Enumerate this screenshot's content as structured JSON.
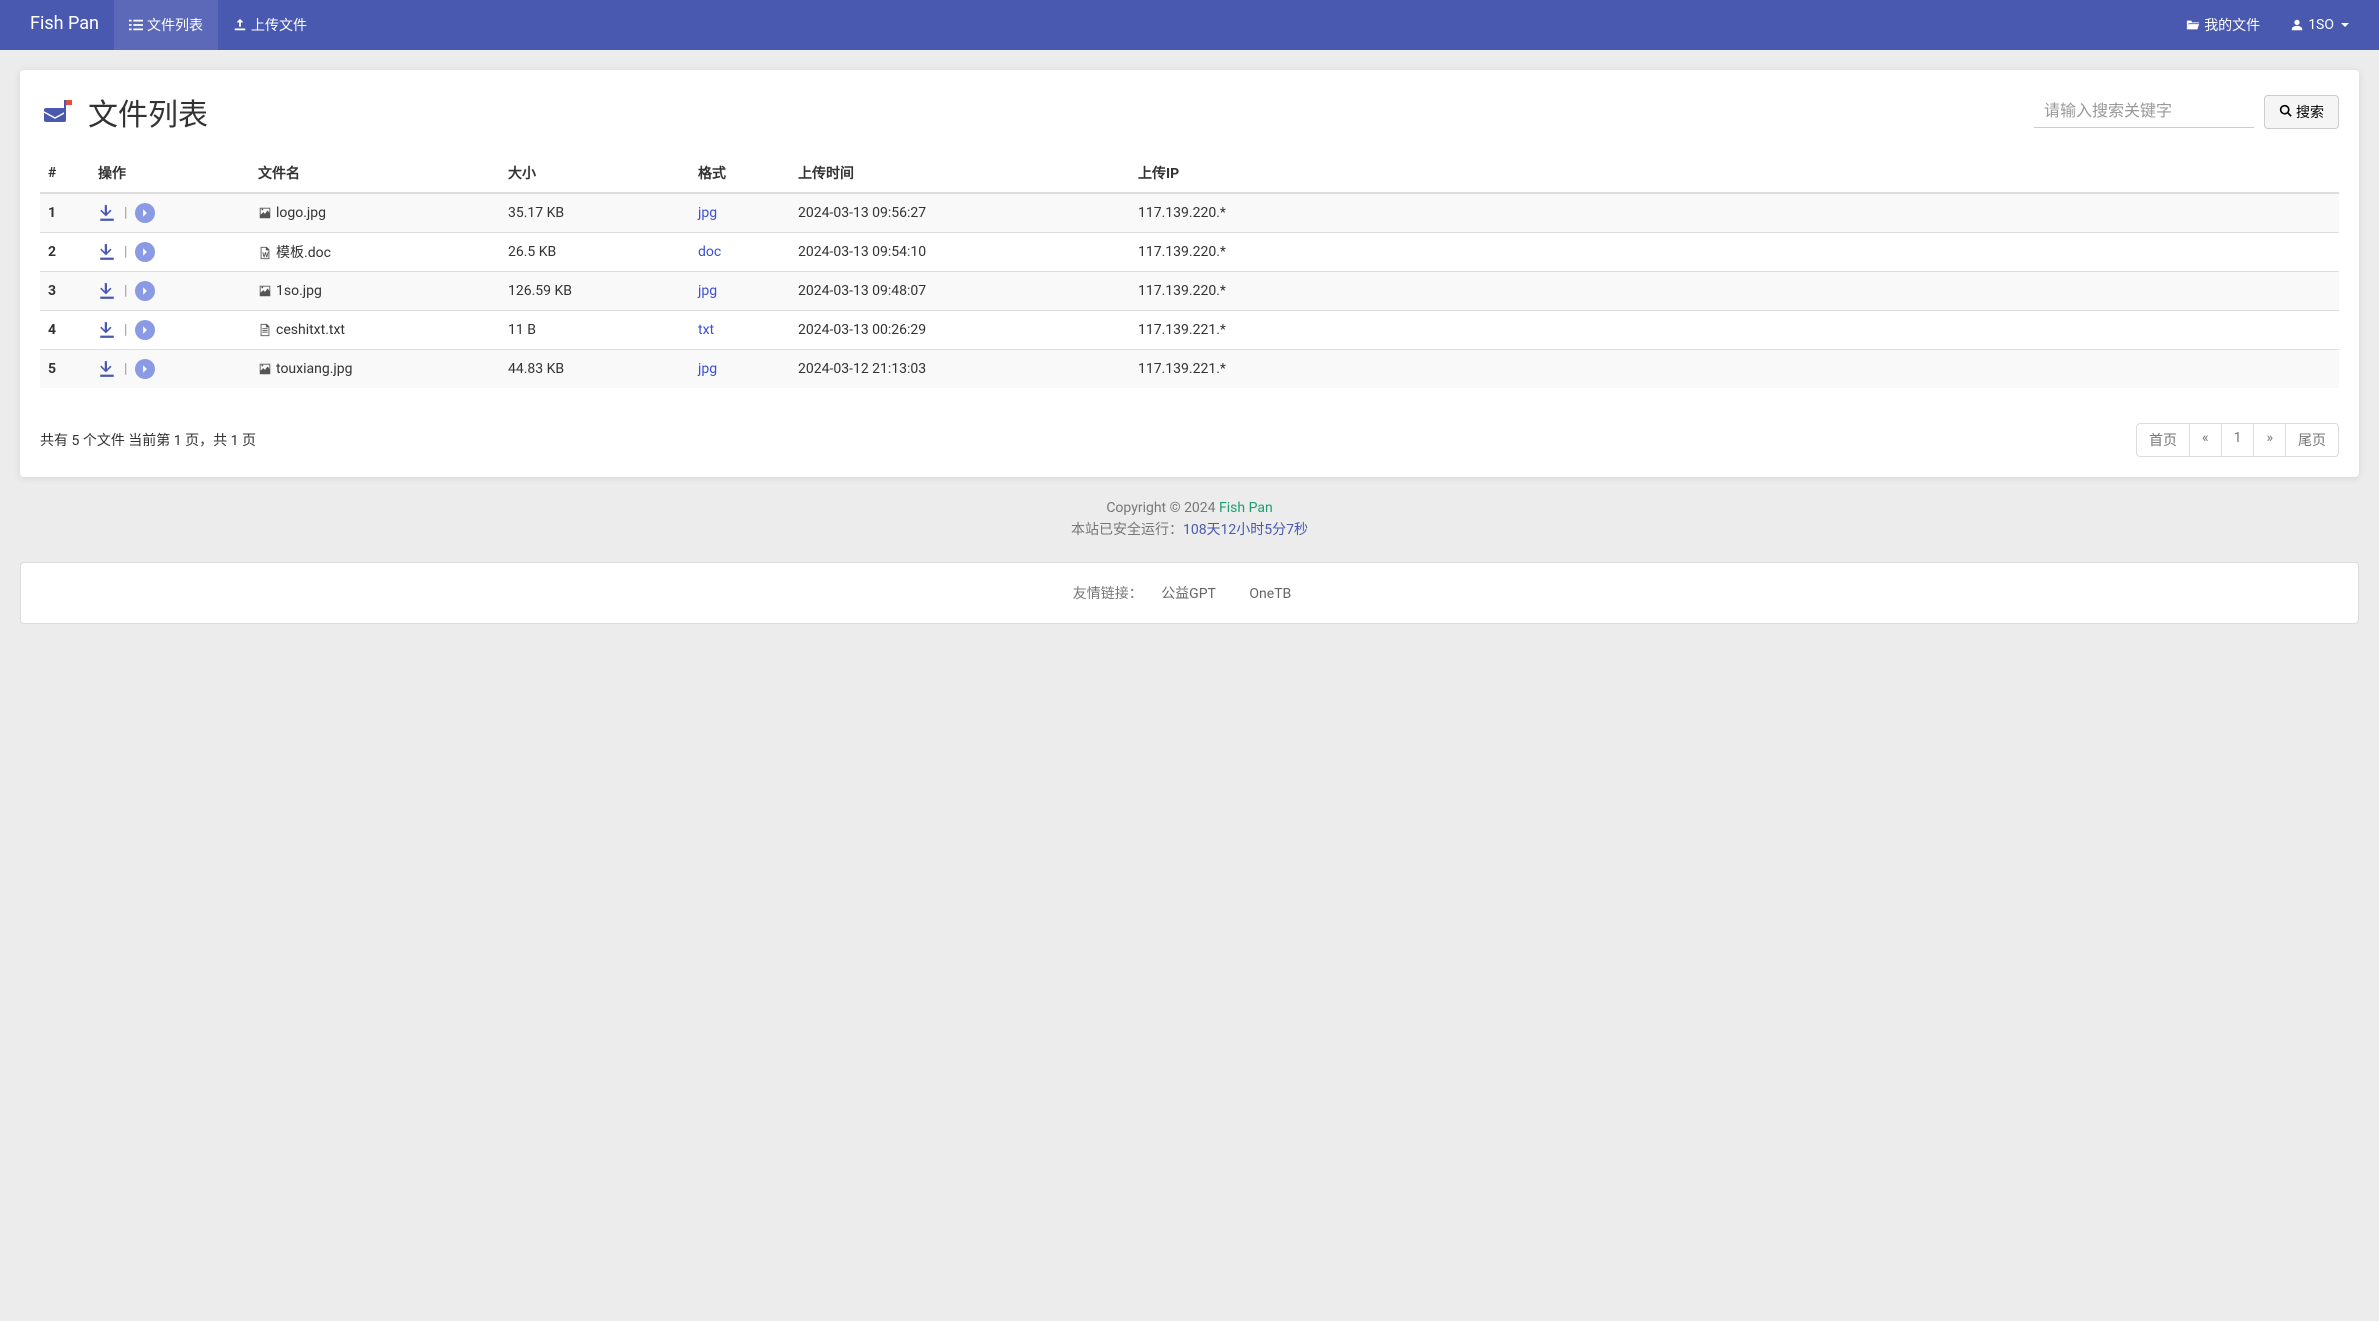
{
  "nav": {
    "brand": "Fish Pan",
    "file_list": "文件列表",
    "upload_file": "上传文件",
    "my_files": "我的文件",
    "user": "1SO"
  },
  "page": {
    "title": "文件列表"
  },
  "search": {
    "placeholder": "请输入搜索关键字",
    "button": "搜索"
  },
  "table": {
    "headers": {
      "index": "#",
      "ops": "操作",
      "name": "文件名",
      "size": "大小",
      "format": "格式",
      "upload_time": "上传时间",
      "upload_ip": "上传IP"
    },
    "rows": [
      {
        "index": "1",
        "name": "logo.jpg",
        "size": "35.17 KB",
        "format": "jpg",
        "time": "2024-03-13 09:56:27",
        "ip": "117.139.220.*",
        "icon": "image"
      },
      {
        "index": "2",
        "name": "模板.doc",
        "size": "26.5 KB",
        "format": "doc",
        "time": "2024-03-13 09:54:10",
        "ip": "117.139.220.*",
        "icon": "word"
      },
      {
        "index": "3",
        "name": "1so.jpg",
        "size": "126.59 KB",
        "format": "jpg",
        "time": "2024-03-13 09:48:07",
        "ip": "117.139.220.*",
        "icon": "image"
      },
      {
        "index": "4",
        "name": "ceshitxt.txt",
        "size": "11 B",
        "format": "txt",
        "time": "2024-03-13 00:26:29",
        "ip": "117.139.221.*",
        "icon": "text"
      },
      {
        "index": "5",
        "name": "touxiang.jpg",
        "size": "44.83 KB",
        "format": "jpg",
        "time": "2024-03-12 21:13:03",
        "ip": "117.139.221.*",
        "icon": "image"
      }
    ]
  },
  "footer_text": {
    "total_prefix": "共有 ",
    "total_count": "5",
    "total_suffix": " 个文件  当前第 ",
    "current_page": "1",
    "page_mid": " 页，共 ",
    "total_pages": "1",
    "page_suffix": " 页"
  },
  "pagination": {
    "first": "首页",
    "prev": "«",
    "page1": "1",
    "next": "»",
    "last": "尾页"
  },
  "copyright": {
    "prefix": "Copyright © 2024 ",
    "brand": "Fish Pan",
    "uptime_prefix": "本站已安全运行：",
    "uptime": "108天12小时5分7秒"
  },
  "links": {
    "label": "友情链接：",
    "link1": "公益GPT",
    "link2": "OneTB"
  }
}
